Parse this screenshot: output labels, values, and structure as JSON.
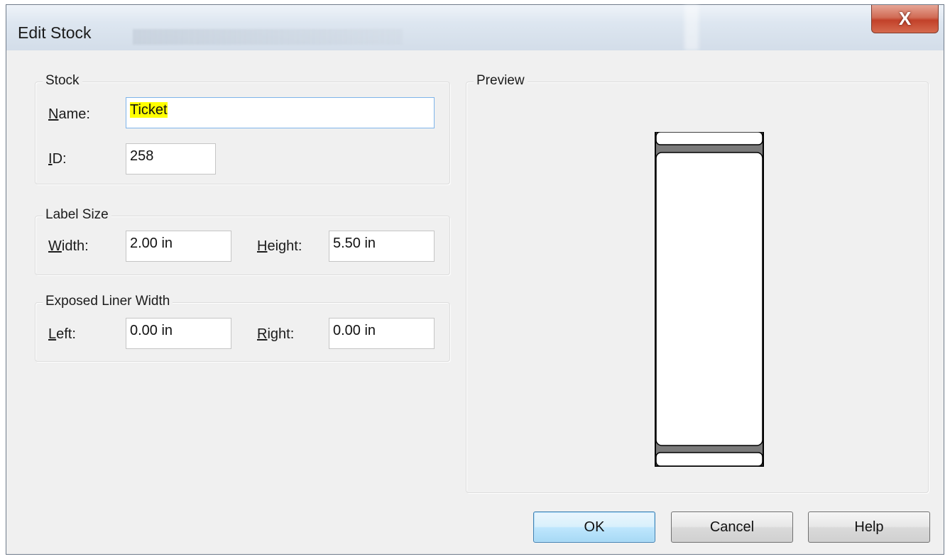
{
  "window": {
    "title": "Edit Stock",
    "close_glyph": "X"
  },
  "stock_group": {
    "label": "Stock",
    "name_label": "Name:",
    "name_mnemonic": "N",
    "name_value": "Ticket",
    "id_label": "ID:",
    "id_mnemonic": "I",
    "id_value": "258"
  },
  "label_size_group": {
    "label": "Label Size",
    "width_label": "Width:",
    "width_mnemonic": "W",
    "width_value": "2.00 in",
    "height_label": "Height:",
    "height_mnemonic": "H",
    "height_value": "5.50 in"
  },
  "liner_group": {
    "label": "Exposed Liner Width",
    "left_label": "Left:",
    "left_mnemonic": "L",
    "left_value": "0.00 in",
    "right_label": "Right:",
    "right_mnemonic": "R",
    "right_value": "0.00 in"
  },
  "preview": {
    "label": "Preview"
  },
  "buttons": {
    "ok": "OK",
    "cancel": "Cancel",
    "help": "Help"
  },
  "colors": {
    "highlight": "#ffff00",
    "focus_border": "#7eb4ea",
    "close_red": "#c2412a"
  }
}
